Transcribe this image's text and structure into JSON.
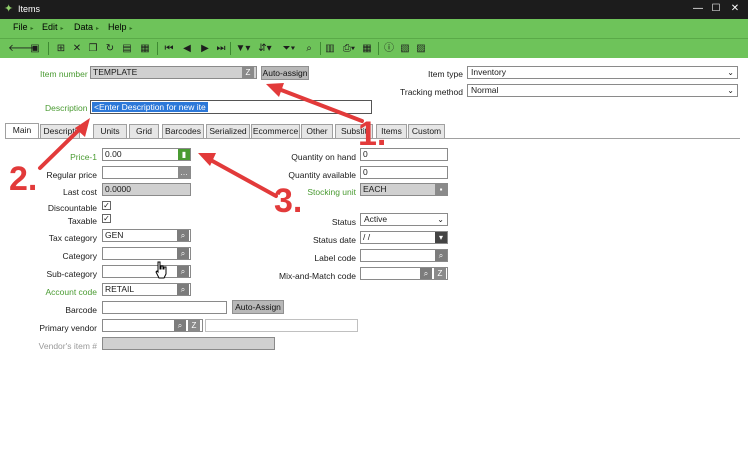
{
  "window": {
    "title": "Items"
  },
  "menu": [
    {
      "label": "File"
    },
    {
      "label": "Edit"
    },
    {
      "label": "Data"
    },
    {
      "label": "Help"
    }
  ],
  "form": {
    "item_number_label": "Item number",
    "item_number_value": "TEMPLATE",
    "auto_assign_label": "Auto-assign",
    "item_type_label": "Item type",
    "item_type_value": "Inventory",
    "tracking_method_label": "Tracking method",
    "tracking_method_value": "Normal",
    "description_label": "Description",
    "description_value": "<Enter Description for new ite"
  },
  "tabs": [
    {
      "label": "Main"
    },
    {
      "label": "Descripti"
    },
    {
      "label": "Units"
    },
    {
      "label": "Grid"
    },
    {
      "label": "Barcodes"
    },
    {
      "label": "Serialized"
    },
    {
      "label": "Ecommerce"
    },
    {
      "label": "Other"
    },
    {
      "label": "Substit"
    },
    {
      "label": "Items"
    },
    {
      "label": "Custom"
    }
  ],
  "main": {
    "price1_label": "Price-1",
    "price1_value": "0.00",
    "regular_price_label": "Regular price",
    "regular_price_value": "",
    "last_cost_label": "Last cost",
    "last_cost_value": "0.0000",
    "discountable_label": "Discountable",
    "discountable_checked": "✓",
    "taxable_label": "Taxable",
    "taxable_checked": "✓",
    "tax_category_label": "Tax category",
    "tax_category_value": "GEN",
    "category_label": "Category",
    "category_value": "",
    "sub_category_label": "Sub-category",
    "sub_category_value": "",
    "account_code_label": "Account code",
    "account_code_value": "RETAIL",
    "barcode_label": "Barcode",
    "barcode_value": "",
    "barcode_auto_assign_label": "Auto-Assign",
    "primary_vendor_label": "Primary vendor",
    "primary_vendor_value": "",
    "vendors_item_label": "Vendor's item #",
    "vendors_item_value": "",
    "qty_on_hand_label": "Quantity on hand",
    "qty_on_hand_value": "0",
    "qty_available_label": "Quantity available",
    "qty_available_value": "0",
    "stocking_unit_label": "Stocking unit",
    "stocking_unit_value": "EACH",
    "status_label": "Status",
    "status_value": "Active",
    "status_date_label": "Status date",
    "status_date_value": " /  /",
    "label_code_label": "Label code",
    "label_code_value": "",
    "mix_match_label": "Mix-and-Match code",
    "mix_match_value": ""
  },
  "annotations": [
    {
      "label": "1."
    },
    {
      "label": "2."
    },
    {
      "label": "3."
    }
  ],
  "colors": {
    "accent": "#6ec35a",
    "annotation": "#e23a3a",
    "label_green": "#4a9b32"
  }
}
